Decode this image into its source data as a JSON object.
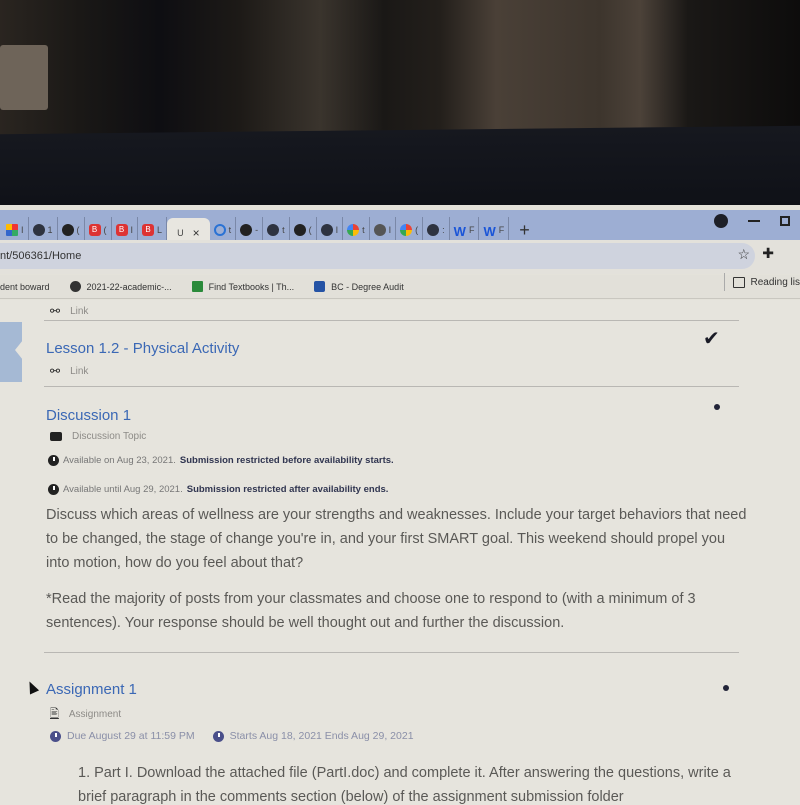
{
  "browser": {
    "tabs": [
      {
        "icon": "apps-grid-icon",
        "letter": "I"
      },
      {
        "icon": "globe-icon",
        "letter": "1"
      },
      {
        "icon": "dark-circle-icon",
        "letter": "("
      },
      {
        "icon": "b-app-icon",
        "letter": "("
      },
      {
        "icon": "b-app-icon",
        "letter": "I"
      },
      {
        "icon": "b-app-icon",
        "letter": "L"
      },
      {
        "icon": "active-tab",
        "letter": "U",
        "active": true
      },
      {
        "icon": "question-circle-icon",
        "letter": "t"
      },
      {
        "icon": "shield-icon",
        "letter": "-"
      },
      {
        "icon": "globe-icon",
        "letter": "t"
      },
      {
        "icon": "dark-circle-icon",
        "letter": "("
      },
      {
        "icon": "globe-icon",
        "letter": "I"
      },
      {
        "icon": "google-icon",
        "letter": "t"
      },
      {
        "icon": "chrome-icon",
        "letter": "I"
      },
      {
        "icon": "google-icon",
        "letter": "("
      },
      {
        "icon": "globe-icon",
        "letter": ":"
      },
      {
        "icon": "word-icon",
        "letter": "F"
      },
      {
        "icon": "word-icon",
        "letter": "F"
      }
    ],
    "close_label": "×",
    "new_tab_label": "+",
    "url": "nt/506361/Home",
    "bookmarks": [
      {
        "label": "dent boward",
        "icon": "none"
      },
      {
        "label": "2021-22-academic-...",
        "icon": "globe-icon"
      },
      {
        "label": "Find Textbooks | Th...",
        "icon": "textbook-icon"
      },
      {
        "label": "BC - Degree Audit",
        "icon": "bc-icon"
      }
    ],
    "reading_list_label": "Reading lis"
  },
  "content": {
    "prev_item": {
      "sub_label": "Link"
    },
    "lesson": {
      "title": "Lesson 1.2 - Physical Activity",
      "type": "Link",
      "status": "completed"
    },
    "discussion": {
      "title": "Discussion 1",
      "type": "Discussion Topic",
      "availability": [
        {
          "prefix": "Available on Aug 23, 2021.",
          "restriction": "Submission restricted before availability starts."
        },
        {
          "prefix": "Available until Aug 29, 2021.",
          "restriction": "Submission restricted after availability ends."
        }
      ],
      "body": [
        "Discuss which areas of wellness are your strengths and weaknesses.  Include your target behaviors that need to be changed, the stage of change you're in, and your first SMART goal.  This weekend should propel you into motion, how do you feel about that?",
        "*Read the majority of posts from your classmates and choose one to respond to (with a minimum of 3 sentences). Your response should be well thought out and further the discussion."
      ]
    },
    "assignment": {
      "title": "Assignment 1",
      "type": "Assignment",
      "due": "Due August 29 at 11:59 PM",
      "window": "Starts Aug 18, 2021  Ends Aug 29, 2021",
      "body": "1. Part I. Download the attached file (PartI.doc) and complete it. After answering the questions, write a brief paragraph in the comments section (below) of the assignment submission folder"
    }
  }
}
